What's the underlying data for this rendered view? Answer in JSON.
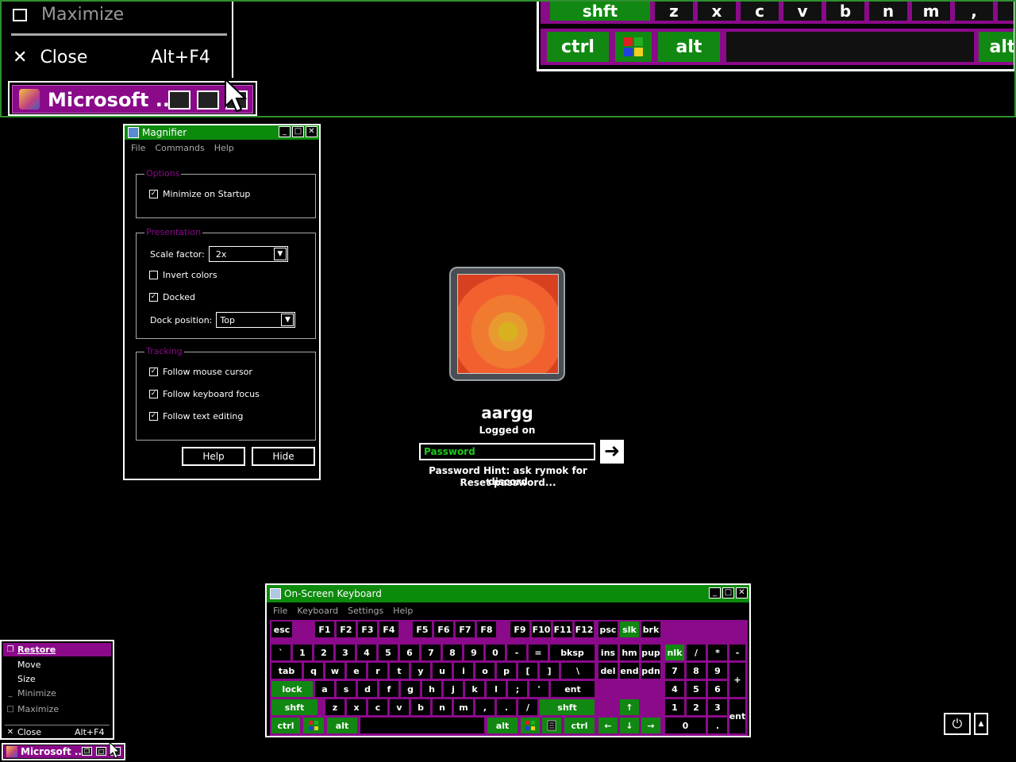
{
  "magnified": {
    "menu_maximize": "Maximize",
    "menu_close": "Close",
    "menu_close_shortcut": "Alt+F4",
    "task_label": "Microsoft ...",
    "kbd_row1": [
      "shft",
      "z",
      "x",
      "c",
      "v",
      "b",
      "n",
      "m",
      ",",
      "."
    ],
    "kbd_ctrl": "ctrl",
    "kbd_alt": "alt",
    "kbd_alt_right": "alt"
  },
  "magnifier": {
    "title": "Magnifier",
    "menu": [
      "File",
      "Commands",
      "Help"
    ],
    "options_title": "Options",
    "minimize_on_startup": "Minimize on Startup",
    "presentation_title": "Presentation",
    "scale_factor_label": "Scale factor:",
    "scale_factor_value": "2x",
    "invert_colors": "Invert colors",
    "docked": "Docked",
    "dock_position_label": "Dock position:",
    "dock_position_value": "Top",
    "tracking_title": "Tracking",
    "follow_mouse": "Follow mouse cursor",
    "follow_keyboard": "Follow keyboard focus",
    "follow_text": "Follow text editing",
    "help_button": "Help",
    "hide_button": "Hide",
    "checks": {
      "minimize": true,
      "invert": false,
      "docked": true,
      "mouse": true,
      "keyboard": true,
      "text": true
    }
  },
  "logon": {
    "user_name": "aargg",
    "status": "Logged on",
    "password_placeholder": "Password",
    "hint": "Password Hint: ask rymok for discord",
    "reset": "Reset password..."
  },
  "osk": {
    "title": "On-Screen Keyboard",
    "menu": [
      "File",
      "Keyboard",
      "Settings",
      "Help"
    ],
    "rows": [
      [
        "esc",
        "F1",
        "F2",
        "F3",
        "F4",
        "F5",
        "F6",
        "F7",
        "F8",
        "F9",
        "F10",
        "F11",
        "F12",
        "psc",
        "slk",
        "brk"
      ],
      [
        "`",
        "1",
        "2",
        "3",
        "4",
        "5",
        "6",
        "7",
        "8",
        "9",
        "0",
        "-",
        "=",
        "bksp",
        "ins",
        "hm",
        "pup",
        "nlk",
        "/",
        "*",
        "-"
      ],
      [
        "tab",
        "q",
        "w",
        "e",
        "r",
        "t",
        "y",
        "u",
        "i",
        "o",
        "p",
        "[",
        "]",
        "\\",
        "del",
        "end",
        "pdn",
        "7",
        "8",
        "9",
        "+"
      ],
      [
        "lock",
        "a",
        "s",
        "d",
        "f",
        "g",
        "h",
        "j",
        "k",
        "l",
        ";",
        "'",
        "ent",
        "4",
        "5",
        "6"
      ],
      [
        "shft",
        "z",
        "x",
        "c",
        "v",
        "b",
        "n",
        "m",
        ",",
        ".",
        "/",
        "shft",
        "↑",
        "1",
        "2",
        "3",
        "ent"
      ],
      [
        "ctrl",
        "alt",
        "alt",
        "ctrl",
        "←",
        "↓",
        "→",
        "0",
        "."
      ]
    ]
  },
  "sysmenu": {
    "restore": "Restore",
    "move": "Move",
    "size": "Size",
    "minimize": "Minimize",
    "maximize": "Maximize",
    "close": "Close",
    "close_shortcut": "Alt+F4",
    "task_label": "Microsoft ..."
  },
  "colors": {
    "accent_green": "#0c8a0c",
    "accent_purple": "#8a0a8a",
    "text_green": "#1ccc1c"
  }
}
